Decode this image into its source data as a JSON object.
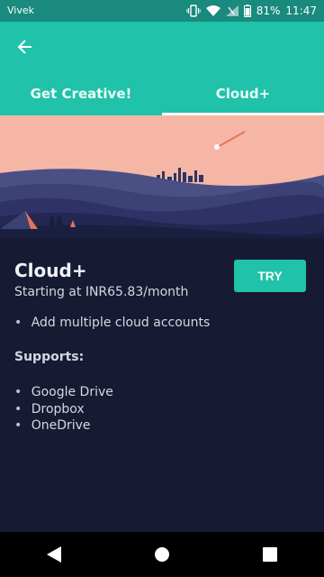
{
  "status_bar": {
    "carrier": "Vivek",
    "battery": "81%",
    "time": "11:47"
  },
  "header": {
    "back_icon": "arrow-back-icon",
    "tabs": [
      {
        "label": "Get Creative!",
        "selected": false
      },
      {
        "label": "Cloud+",
        "selected": true
      }
    ]
  },
  "plan": {
    "title": "Cloud+",
    "price": "Starting at INR65.83/month",
    "try_label": "TRY",
    "features": [
      "Add multiple cloud accounts"
    ],
    "supports_label": "Supports:",
    "supports": [
      "Google Drive",
      "Dropbox",
      "OneDrive"
    ]
  },
  "colors": {
    "accent": "#20c2a9",
    "status_bar": "#198a7d",
    "background": "#161a33",
    "sky": "#f6b6a6"
  }
}
